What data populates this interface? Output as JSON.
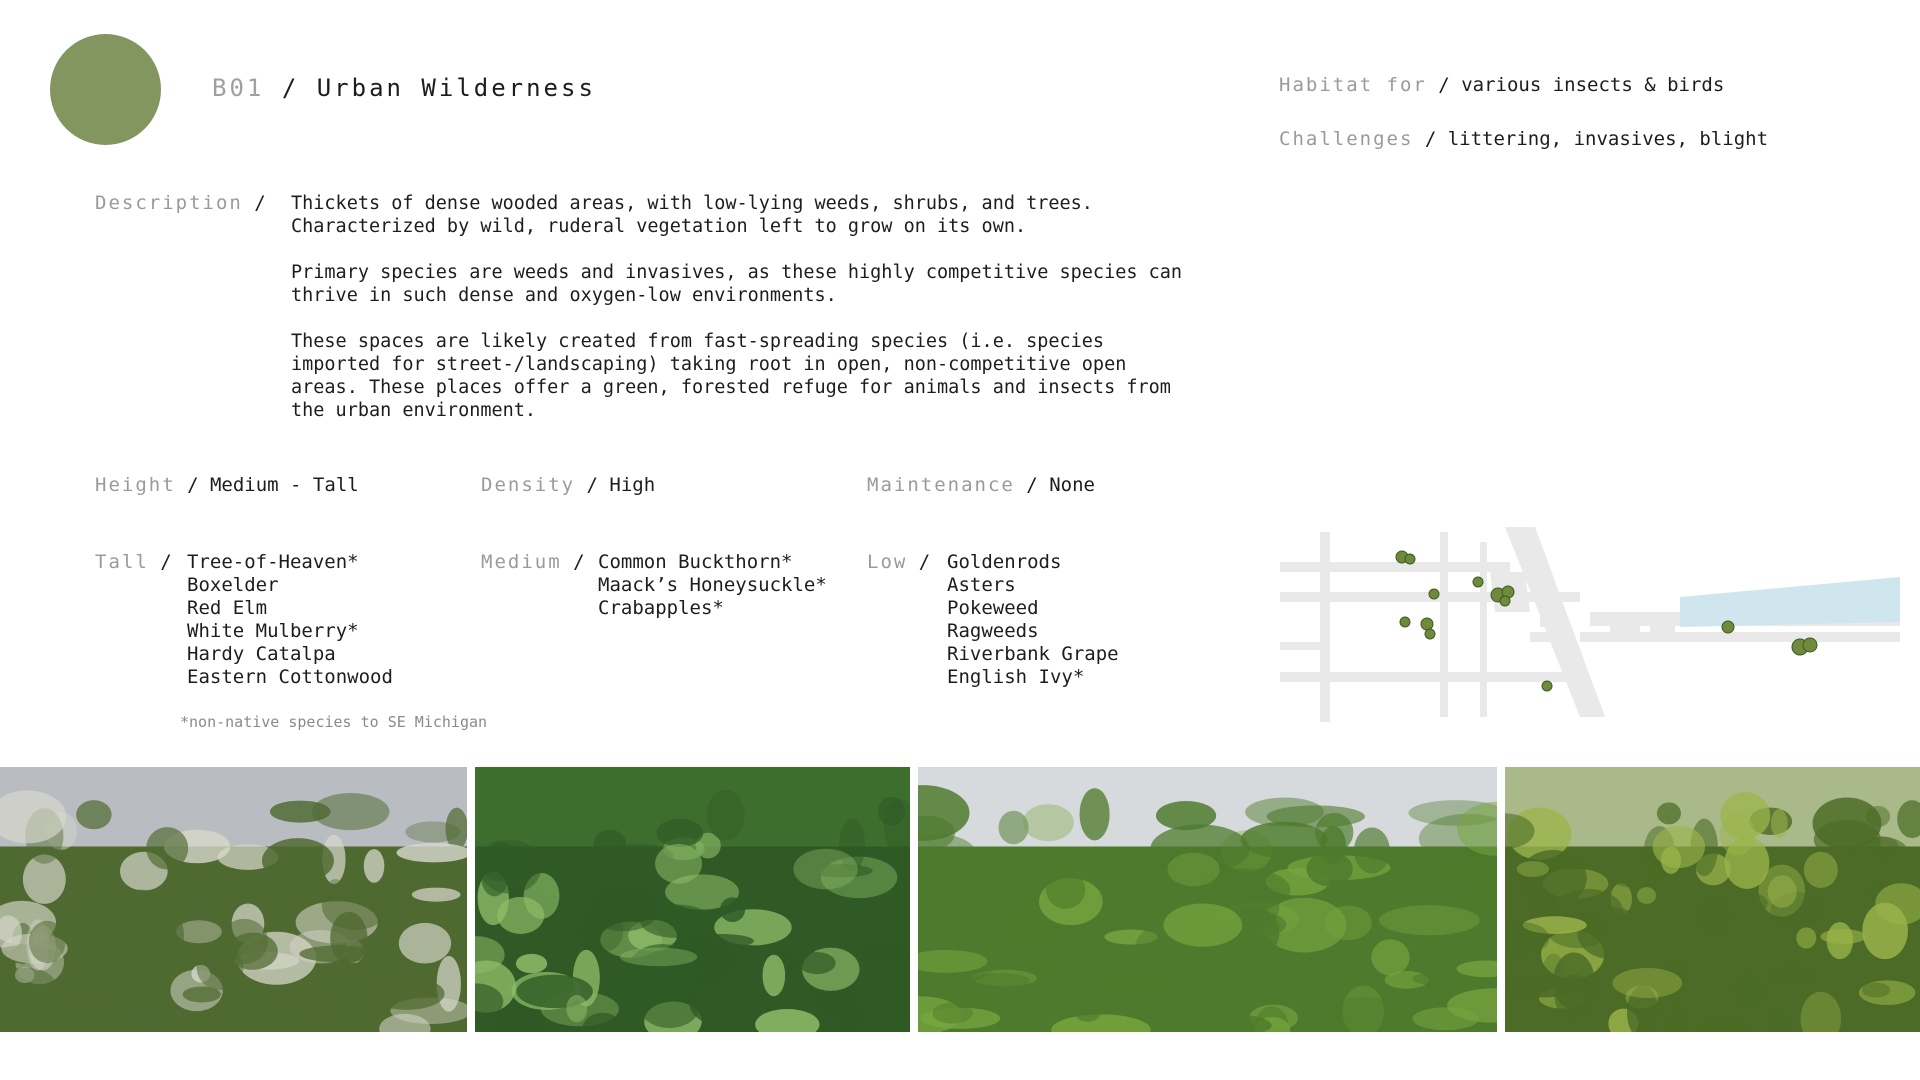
{
  "header": {
    "code": "B01",
    "title": "Urban Wilderness",
    "badge_color": "#84965f"
  },
  "habitat": {
    "label": "Habitat for",
    "value": "various insects & birds"
  },
  "challenges": {
    "label": "Challenges",
    "value": "littering, invasives, blight"
  },
  "description": {
    "label": "Description",
    "paragraphs": [
      "Thickets of dense wooded areas, with low-lying weeds, shrubs, and trees.\nCharacterized by wild, ruderal vegetation left to grow on its own.",
      "Primary species are weeds and invasives, as these highly competitive species can\nthrive in such dense and oxygen-low environments.",
      "These spaces are likely created from fast-spreading species (i.e. species\nimported for street-/landscaping) taking root in open, non-competitive open\nareas. These places offer a green, forested refuge for animals and insects from\nthe urban environment."
    ]
  },
  "attributes": {
    "height": {
      "label": "Height",
      "value": "Medium - Tall"
    },
    "density": {
      "label": "Density",
      "value": "High"
    },
    "maintenance": {
      "label": "Maintenance",
      "value": "None"
    }
  },
  "species": {
    "tall": {
      "label": "Tall",
      "items": [
        "Tree-of-Heaven*",
        "Boxelder",
        "Red Elm",
        "White Mulberry*",
        "Hardy Catalpa",
        "Eastern Cottonwood"
      ]
    },
    "medium": {
      "label": "Medium",
      "items": [
        "Common Buckthorn*",
        "Maack’s Honeysuckle*",
        "Crabapples*"
      ]
    },
    "low": {
      "label": "Low",
      "items": [
        "Goldenrods",
        "Asters",
        "Pokeweed",
        "Ragweeds",
        "Riverbank Grape",
        "English Ivy*"
      ]
    }
  },
  "footnote": "*non-native species to SE Michigan",
  "map": {
    "street_color": "#e9e9e9",
    "water_color": "#cfe6ee",
    "patch_color": "#6f8a3c"
  },
  "photos": [
    {
      "name": "roadside-weeds-photo",
      "sky": "#b9bcc0",
      "base": "#4f6a31",
      "accent": "#d8d8cc"
    },
    {
      "name": "dense-vines-photo",
      "sky": "#3e6e2e",
      "base": "#2f5a25",
      "accent": "#8fbf6a"
    },
    {
      "name": "overgrown-lot-photo",
      "sky": "#d7dadc",
      "base": "#4d7a2c",
      "accent": "#78a53f"
    },
    {
      "name": "thicket-edge-photo",
      "sky": "#a9b98a",
      "base": "#4b6b26",
      "accent": "#9bb54a"
    }
  ]
}
